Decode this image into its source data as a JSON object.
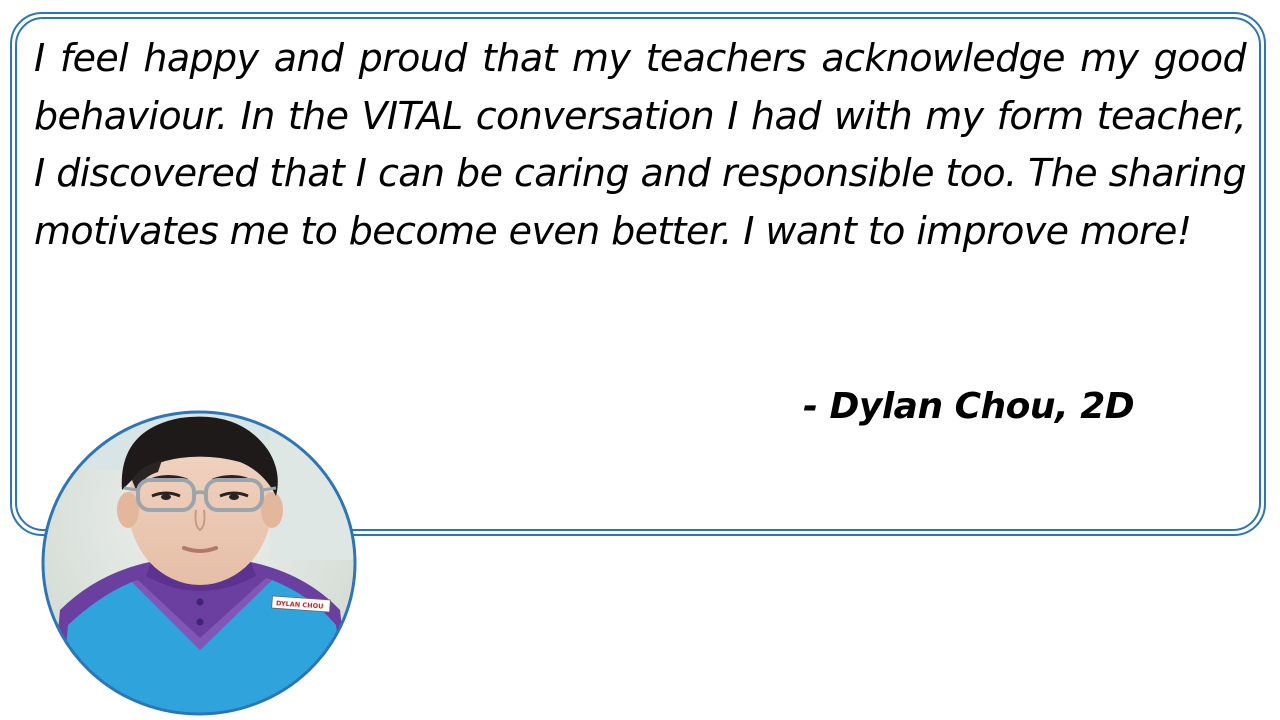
{
  "quote": {
    "text": "I feel happy and proud that my teachers acknowledge my good behaviour. In the VITAL conversation I had with my form teacher, I discovered that I can be caring and responsible too. The sharing motivates me to become even better. I want to improve more!",
    "attribution": "- Dylan Chou, 2D"
  },
  "photo": {
    "name_tag": "DYLAN CHOU"
  },
  "colors": {
    "frame_border": "#2e75b6",
    "background": "#ffffff",
    "text": "#000000",
    "shirt_blue": "#2ea3dc",
    "shirt_purple": "#6b3fa0"
  }
}
